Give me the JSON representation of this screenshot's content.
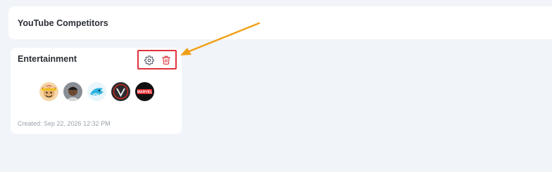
{
  "header": {
    "title": "YouTube Competitors"
  },
  "card": {
    "title": "Entertainment",
    "created": "Created: Sep 22, 2026 12:32 PM",
    "channels": [
      {
        "name": "channel-1",
        "icon": "avatar-anime-character"
      },
      {
        "name": "channel-2",
        "icon": "avatar-person-cap"
      },
      {
        "name": "channel-3",
        "icon": "avatar-shark-logo"
      },
      {
        "name": "channel-4",
        "icon": "avatar-dark-logo"
      },
      {
        "name": "channel-5",
        "icon": "avatar-marvel-logo"
      }
    ],
    "actions": [
      {
        "name": "settings",
        "icon": "gear-icon"
      },
      {
        "name": "delete",
        "icon": "trash-icon"
      }
    ]
  },
  "avatar_texts": {
    "marvel": "MARVEL"
  },
  "colors": {
    "page_bg": "#f1f4f8",
    "highlight": "#e0333c",
    "arrow": "#f0a018",
    "trash": "#e0333c"
  }
}
